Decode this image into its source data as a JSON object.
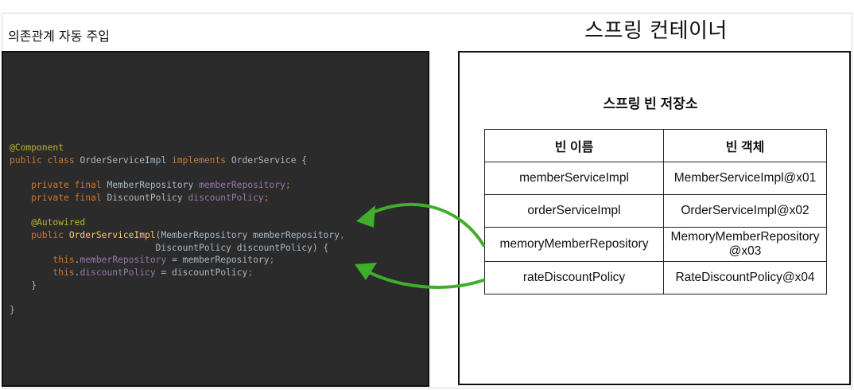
{
  "header": {
    "page_title": "의존관계 자동 주입",
    "container_title": "스프링 컨테이너"
  },
  "code": {
    "lines": [
      [
        {
          "t": "@Component",
          "c": "anno"
        }
      ],
      [
        {
          "t": "public class ",
          "c": "kw"
        },
        {
          "t": "OrderServiceImpl ",
          "c": "plain"
        },
        {
          "t": "implements ",
          "c": "kw"
        },
        {
          "t": "OrderService {",
          "c": "plain"
        }
      ],
      [],
      [
        {
          "t": "    private final ",
          "c": "kw"
        },
        {
          "t": "MemberRepository ",
          "c": "plain"
        },
        {
          "t": "memberRepository",
          "c": "field"
        },
        {
          "t": ";",
          "c": "kw"
        }
      ],
      [
        {
          "t": "    private final ",
          "c": "kw"
        },
        {
          "t": "DiscountPolicy ",
          "c": "plain"
        },
        {
          "t": "discountPolicy",
          "c": "field"
        },
        {
          "t": ";",
          "c": "kw"
        }
      ],
      [],
      [
        {
          "t": "    @Autowired",
          "c": "anno"
        }
      ],
      [
        {
          "t": "    public ",
          "c": "kw"
        },
        {
          "t": "OrderServiceImpl",
          "c": "fn"
        },
        {
          "t": "(MemberRepository memberRepository",
          "c": "plain"
        },
        {
          "t": ",",
          "c": "kw"
        }
      ],
      [
        {
          "t": "                           DiscountPolicy discountPolicy) {",
          "c": "plain"
        }
      ],
      [
        {
          "t": "        this",
          "c": "kw"
        },
        {
          "t": ".",
          "c": "plain"
        },
        {
          "t": "memberRepository",
          "c": "field"
        },
        {
          "t": " = memberRepository",
          "c": "plain"
        },
        {
          "t": ";",
          "c": "kw"
        }
      ],
      [
        {
          "t": "        this",
          "c": "kw"
        },
        {
          "t": ".",
          "c": "plain"
        },
        {
          "t": "discountPolicy",
          "c": "field"
        },
        {
          "t": " = discountPolicy",
          "c": "plain"
        },
        {
          "t": ";",
          "c": "kw"
        }
      ],
      [
        {
          "t": "    }",
          "c": "plain"
        }
      ],
      [],
      [
        {
          "t": "}",
          "c": "plain"
        }
      ]
    ]
  },
  "repository": {
    "title": "스프링 빈 저장소",
    "headers": [
      "빈 이름",
      "빈 객체"
    ],
    "rows": [
      [
        "memberServiceImpl",
        "MemberServiceImpl@x01"
      ],
      [
        "orderServiceImpl",
        "OrderServiceImpl@x02"
      ],
      [
        "memoryMemberRepository",
        "MemoryMemberRepository\n@x03"
      ],
      [
        "rateDiscountPolicy",
        "RateDiscountPolicy@x04"
      ]
    ]
  },
  "colors": {
    "code_bg": "#2b2b2b",
    "arrow": "#3fae2a",
    "keyword": "#cc7832",
    "annotation": "#bbb529",
    "field": "#9876aa"
  }
}
